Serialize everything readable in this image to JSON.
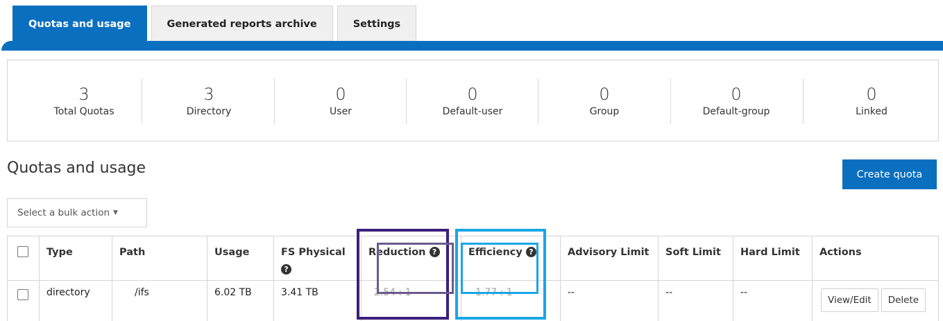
{
  "tabs": [
    {
      "label": "Quotas and usage",
      "active": true
    },
    {
      "label": "Generated reports archive",
      "active": false
    },
    {
      "label": "Settings",
      "active": false
    }
  ],
  "summary": [
    {
      "count": "3",
      "label": "Total Quotas"
    },
    {
      "count": "3",
      "label": "Directory"
    },
    {
      "count": "0",
      "label": "User"
    },
    {
      "count": "0",
      "label": "Default-user"
    },
    {
      "count": "0",
      "label": "Group"
    },
    {
      "count": "0",
      "label": "Default-group"
    },
    {
      "count": "0",
      "label": "Linked"
    }
  ],
  "section_title": "Quotas and usage",
  "create_button": "Create quota",
  "bulk_action": {
    "label": "Select a bulk action",
    "icon": "caret-down-icon"
  },
  "table": {
    "headers": {
      "type": "Type",
      "path": "Path",
      "usage": "Usage",
      "fs_physical": "FS Physical",
      "reduction": "Reduction",
      "efficiency": "Efficiency",
      "advisory_limit": "Advisory Limit",
      "soft_limit": "Soft Limit",
      "hard_limit": "Hard Limit",
      "actions": "Actions"
    },
    "help_icon": "question-circle-icon",
    "rows": [
      {
        "type": "directory",
        "path": "/ifs",
        "usage": "6.02 TB",
        "fs_physical": "3.41 TB",
        "reduction": "2.54 : 1",
        "efficiency": "1.77 : 1",
        "advisory_limit": "--",
        "soft_limit": "--",
        "hard_limit": "--",
        "actions": [
          "View/Edit",
          "Delete"
        ]
      }
    ]
  },
  "colors": {
    "accent": "#0b6fbf",
    "highlight_purple": "#3b1f7a",
    "highlight_purple_inner": "#6a5a8e",
    "highlight_cyan": "#1aa6e6"
  }
}
